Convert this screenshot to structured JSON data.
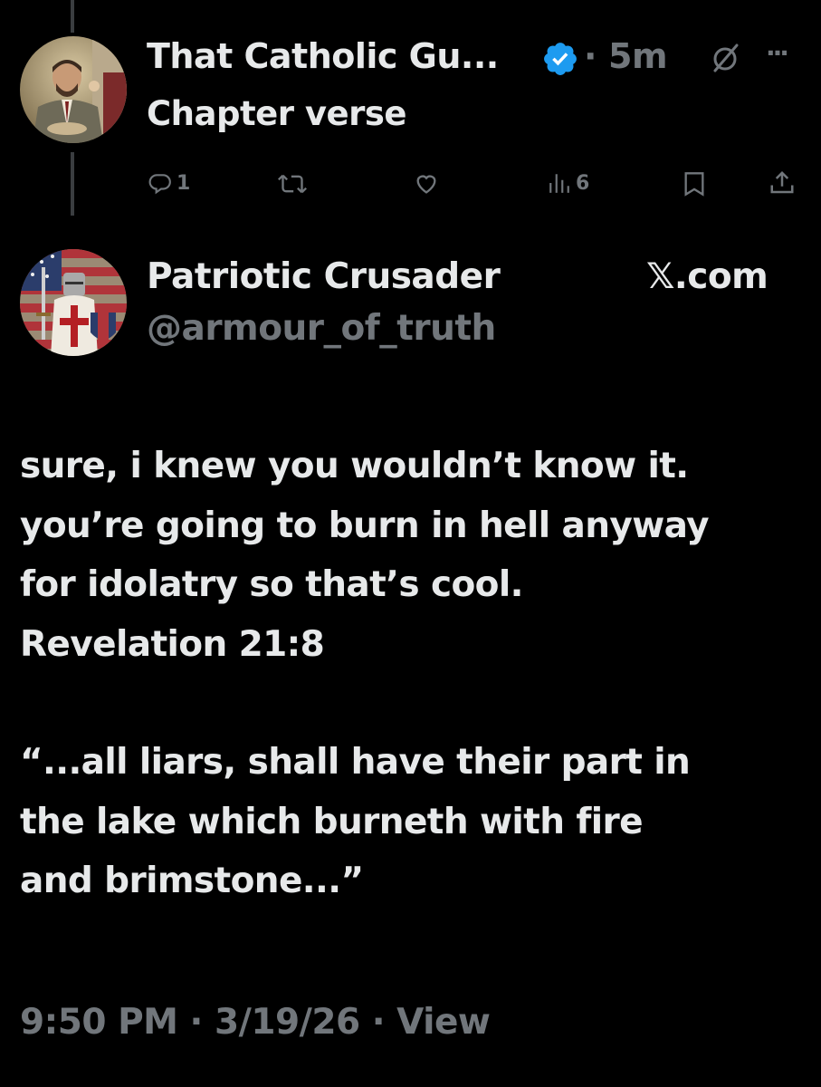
{
  "parent_tweet": {
    "author_name": "That Catholic Gu...",
    "time_sep": "·",
    "time_ago": "5m",
    "text": "Chapter verse",
    "more_glyph": "···",
    "actions": {
      "reply_count": "1",
      "retweet_count": "",
      "like_count": "",
      "views_count": "6"
    }
  },
  "quoted_profile": {
    "display_name": "Patriotic Crusader",
    "handle": "@armour_of_truth",
    "source": "𝕏.com"
  },
  "post": {
    "lines": [
      "sure, i knew you wouldn’t know it.",
      "you’re going to burn in hell anyway",
      "for idolatry so that’s cool.",
      "Revelation 21:8"
    ],
    "quote_lines": [
      "“...all liars, shall have their part in",
      "the lake which burneth with fire",
      "and brimstone...”"
    ],
    "timestamp": "9:50 PM · 3/19/26 · View"
  },
  "icons": {
    "verified": "verified-badge-icon",
    "grok": "grok-icon",
    "more": "more-icon",
    "reply": "reply-icon",
    "retweet": "retweet-icon",
    "like": "like-icon",
    "views": "views-icon",
    "bookmark": "bookmark-icon",
    "share": "share-icon"
  },
  "colors": {
    "background": "#000000",
    "text": "#e7e9ea",
    "muted": "#71767b",
    "verified": "#1d9bf0"
  }
}
